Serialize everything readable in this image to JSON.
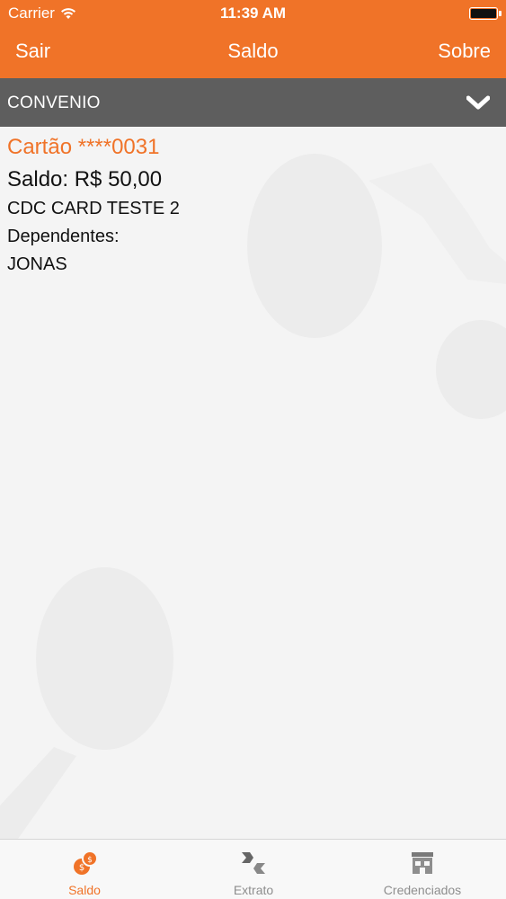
{
  "status_bar": {
    "carrier": "Carrier",
    "time": "11:39 AM"
  },
  "nav": {
    "left_button": "Sair",
    "title": "Saldo",
    "right_button": "Sobre"
  },
  "section": {
    "label": "CONVENIO",
    "icon": "chevron-down-icon"
  },
  "card": {
    "number": "Cartão ****0031",
    "balance": "Saldo: R$ 50,00",
    "holder": "CDC CARD TESTE 2",
    "dependents_label": "Dependentes:",
    "dependents": [
      "JONAS"
    ]
  },
  "tabs": [
    {
      "label": "Saldo",
      "icon": "coins-icon",
      "active": true
    },
    {
      "label": "Extrato",
      "icon": "extrato-arrows-icon",
      "active": false
    },
    {
      "label": "Credenciados",
      "icon": "store-icon",
      "active": false
    }
  ],
  "colors": {
    "accent": "#f07328",
    "section_bg": "#5e5e5e",
    "tab_inactive": "#8e8e8e"
  }
}
